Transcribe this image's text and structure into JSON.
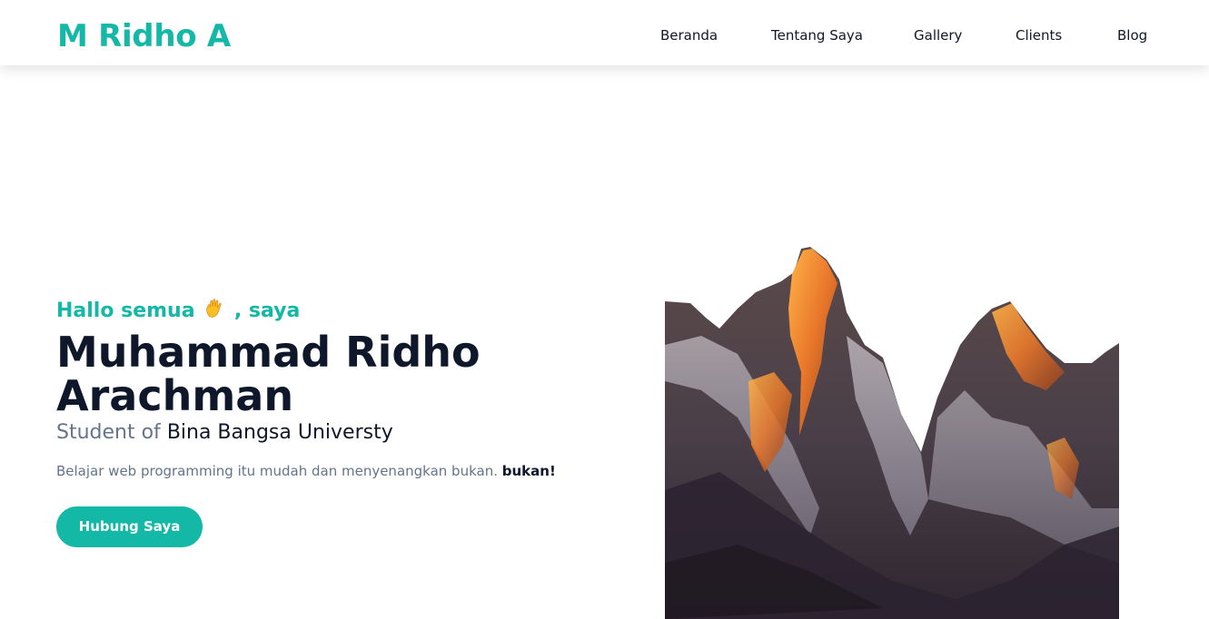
{
  "nav": {
    "brand": "M Ridho A",
    "links": [
      "Beranda",
      "Tentang Saya",
      "Gallery",
      "Clients",
      "Blog"
    ]
  },
  "hero": {
    "greeting_before": "Hallo semua",
    "greeting_after": ", saya",
    "greeting_icon": "waving-hand-icon",
    "name": "Muhammad Ridho Arachman",
    "subtitle_prefix": "Student of",
    "subtitle_school": "Bina Bangsa Universty",
    "tagline_text": "Belajar web programming itu mudah dan menyenangkan bukan.",
    "tagline_bold": "bukan!",
    "cta_label": "Hubung Saya",
    "image_icon": "mountain-landscape-image"
  },
  "colors": {
    "accent": "#14b8a6",
    "heading": "#0f172a",
    "muted": "#64748b"
  }
}
